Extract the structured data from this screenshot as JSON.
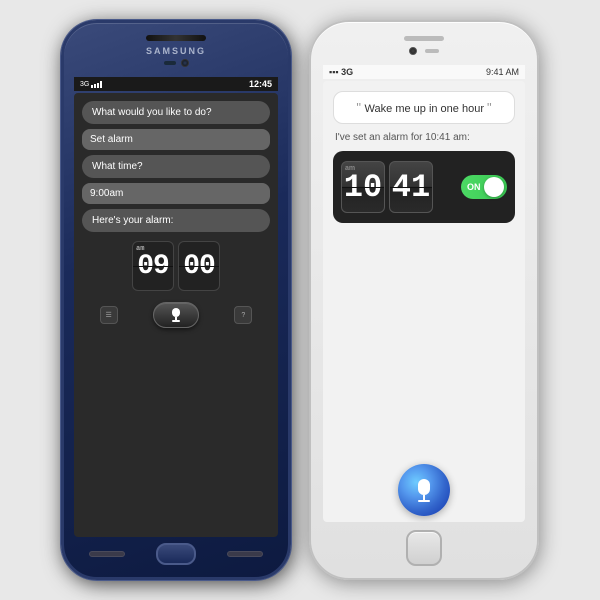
{
  "samsung": {
    "brand": "SAMSUNG",
    "time": "12:45",
    "network": "3G",
    "conversation": [
      {
        "type": "prompt",
        "text": "What would you like to do?"
      },
      {
        "type": "response",
        "text": "Set alarm"
      },
      {
        "type": "prompt",
        "text": "What time?"
      },
      {
        "type": "response",
        "text": "9:00am"
      },
      {
        "type": "prompt",
        "text": "Here's your alarm:"
      }
    ],
    "alarm_hour": "09",
    "alarm_minute": "00",
    "am_label": "am"
  },
  "iphone": {
    "network": "3G",
    "time": "9:41 AM",
    "signal": "▪▪▪",
    "query": "Wake me up in one hour",
    "response": "I've set an alarm for 10:41 am:",
    "alarm_hour": "10",
    "alarm_minute": "41",
    "am_label": "am",
    "toggle_label": "ON"
  }
}
